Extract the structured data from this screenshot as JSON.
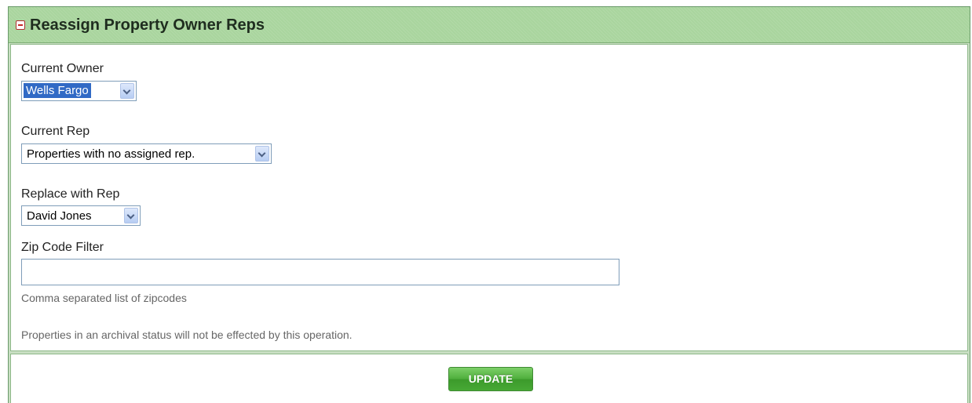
{
  "panel": {
    "title": "Reassign Property Owner Reps",
    "collapse_icon": "minus-box-icon"
  },
  "form": {
    "current_owner": {
      "label": "Current Owner",
      "value": "Wells Fargo"
    },
    "current_rep": {
      "label": "Current Rep",
      "value": "Properties with no assigned rep."
    },
    "replace_rep": {
      "label": "Replace with Rep",
      "value": "David Jones"
    },
    "zip_filter": {
      "label": "Zip Code Filter",
      "value": "",
      "placeholder": "",
      "hint": "Comma separated list of zipcodes"
    },
    "archival_note": "Properties in an archival status will not be effected by this operation."
  },
  "footer": {
    "update_label": "UPDATE"
  },
  "colors": {
    "header_bg": "#a9d59e",
    "button_green": "#4eae3c",
    "selection_blue": "#316ac5"
  }
}
